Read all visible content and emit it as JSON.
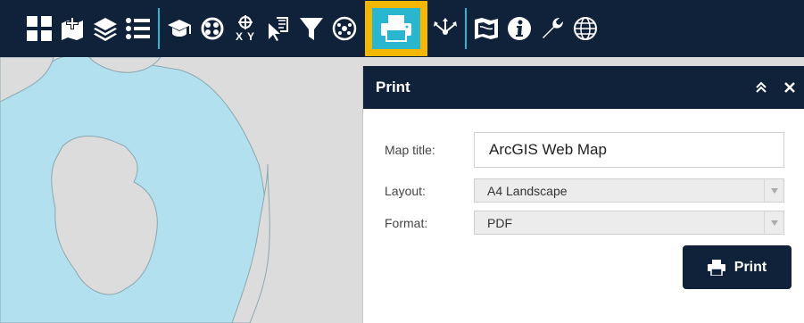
{
  "toolbar": {
    "items": [
      {
        "name": "apps-grid-icon"
      },
      {
        "name": "add-data-icon"
      },
      {
        "name": "layers-icon"
      },
      {
        "name": "legend-list-icon"
      },
      {
        "name": "basemap-gallery-icon"
      },
      {
        "name": "analysis-icon"
      },
      {
        "name": "coordinate-xy-icon"
      },
      {
        "name": "select-icon"
      },
      {
        "name": "filter-icon"
      },
      {
        "name": "situation-awareness-icon"
      },
      {
        "name": "print-icon",
        "active": true
      },
      {
        "name": "share-icon"
      },
      {
        "name": "bookmark-map-icon"
      },
      {
        "name": "info-icon"
      },
      {
        "name": "settings-wrench-icon"
      },
      {
        "name": "globe-icon"
      }
    ],
    "active_color": "#f5b800",
    "accent_color": "#2bb6cf",
    "bar_color": "#10213a"
  },
  "panel": {
    "title": "Print",
    "collapse_icon": "double-chevron-up-icon",
    "close_icon": "close-icon",
    "fields": {
      "map_title_label": "Map title:",
      "map_title_value": "ArcGIS Web Map",
      "layout_label": "Layout:",
      "layout_value": "A4 Landscape",
      "format_label": "Format:",
      "format_value": "PDF"
    },
    "print_button_label": "Print"
  },
  "map": {
    "water_color": "#b3e0ee",
    "land_color": "#dcdcdc"
  }
}
